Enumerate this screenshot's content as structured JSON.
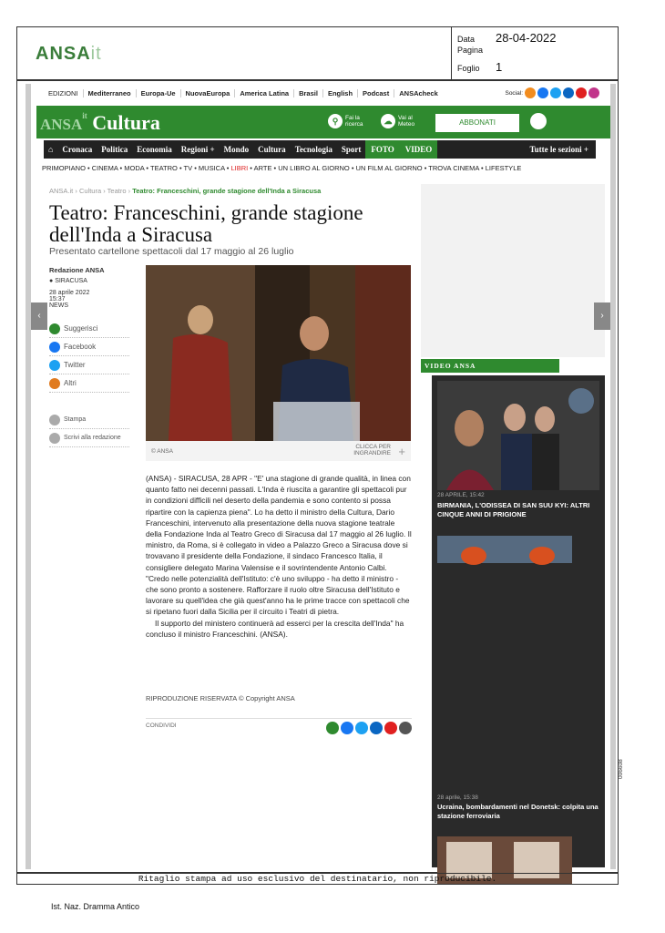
{
  "clipping": {
    "logo": "ANSA",
    "logo_suffix": "it",
    "date_label": "Data",
    "date_value": "28-04-2022",
    "page_label": "Pagina",
    "page_value": "",
    "sheet_label": "Foglio",
    "sheet_value": "1"
  },
  "topnav": [
    "EDIZIONI",
    "Mediterraneo",
    "Europa-Ue",
    "NuovaEuropa",
    "America Latina",
    "Brasil",
    "English",
    "Podcast",
    "ANSAcheck"
  ],
  "social_label": "Social:",
  "brand": {
    "ansa": "ANSA",
    "it": "it",
    "section": "Cultura"
  },
  "tools": {
    "search": "Fai la ricerca",
    "meteo": "Vai al Meteo",
    "subscribe": "ABBONATI"
  },
  "secnav": [
    "Cronaca",
    "Politica",
    "Economia",
    "Regioni +",
    "Mondo",
    "Cultura",
    "Tecnologia",
    "Sport",
    "FOTO",
    "VIDEO",
    "Tutte le sezioni +"
  ],
  "subnav": "PRIMOPIANO • CINEMA • MODA • TEATRO • TV • MUSICA • ",
  "subnav_red": "LIBRI",
  "subnav_rest": " • ARTE • UN LIBRO AL GIORNO • UN FILM AL GIORNO • TROVA CINEMA • LIFESTYLE",
  "breadcrumb": {
    "a": "ANSA.it",
    "b": "Cultura",
    "c": "Teatro",
    "current": "Teatro: Franceschini, grande stagione dell'Inda a Siracusa"
  },
  "article": {
    "title": "Teatro: Franceschini, grande stagione dell'Inda a Siracusa",
    "subtitle": "Presentato cartellone spettacoli dal 17 maggio al 26 luglio",
    "author": "Redazione ANSA",
    "place": "SIRACUSA",
    "date": "28 aprile 2022",
    "time": "15:37",
    "tag": "NEWS",
    "photo_credit": "© ANSA",
    "enlarge": "CLICCA PER INGRANDIRE",
    "paragraph1": "(ANSA) - SIRACUSA, 28 APR - \"E' una stagione di grande qualità, in linea con quanto fatto nei decenni passati. L'Inda è riuscita a garantire gli spettacoli pur in condizioni difficili nel deserto della pandemia e sono contento si possa ripartire con la capienza piena\". Lo ha detto il ministro della Cultura, Dario Franceschini, intervenuto alla presentazione della nuova stagione teatrale della Fondazione Inda al Teatro Greco di Siracusa dal 17 maggio al 26 luglio. Il ministro, da Roma, si è collegato in video a Palazzo Greco a Siracusa dove si trovavano il presidente della Fondazione, il sindaco Francesco Italia, il consigliere delegato Marina Valensise e il sovrintendente Antonio Calbi. \"Credo nelle potenzialità dell'Istituto: c'è uno sviluppo - ha detto il ministro - che sono pronto a sostenere. Rafforzare il ruolo oltre Siracusa dell'Istituto e lavorare su quell'idea che già quest'anno ha le prime tracce con spettacoli che si ripetano fuori dalla Sicilia per il circuito i Teatri di pietra.",
    "paragraph2": "Il supporto del ministero continuerà ad esserci per la crescita dell'Inda\" ha concluso il ministro Franceschini. (ANSA).",
    "copyright": "RIPRODUZIONE RISERVATA © Copyright ANSA",
    "share": "CONDIVIDI"
  },
  "sidebar": {
    "suggest": "Suggerisci",
    "facebook": "Facebook",
    "twitter": "Twitter",
    "others": "Altri",
    "print": "Stampa",
    "write": "Scrivi alla redazione"
  },
  "video": {
    "header": "VIDEO ANSA",
    "v1_date": "28 APRILE, 15:42",
    "v1_title": "BIRMANIA, L'ODISSEA DI SAN SUU KYI: ALTRI CINQUE ANNI DI PRIGIONE",
    "v2_date": "28 aprile, 15:38",
    "v2_title": "Ucraina, bombardamenti nel Donetsk: colpita una stazione ferroviaria"
  },
  "footer": "Ritaglio stampa ad uso esclusivo del destinatario, non riproducibile.",
  "source": "Ist. Naz. Dramma Antico",
  "doc_code": "006608",
  "colors": {
    "ansa_green": "#2f8a2f",
    "nav_dark": "#222222",
    "video_bg": "#2a2a2a"
  }
}
